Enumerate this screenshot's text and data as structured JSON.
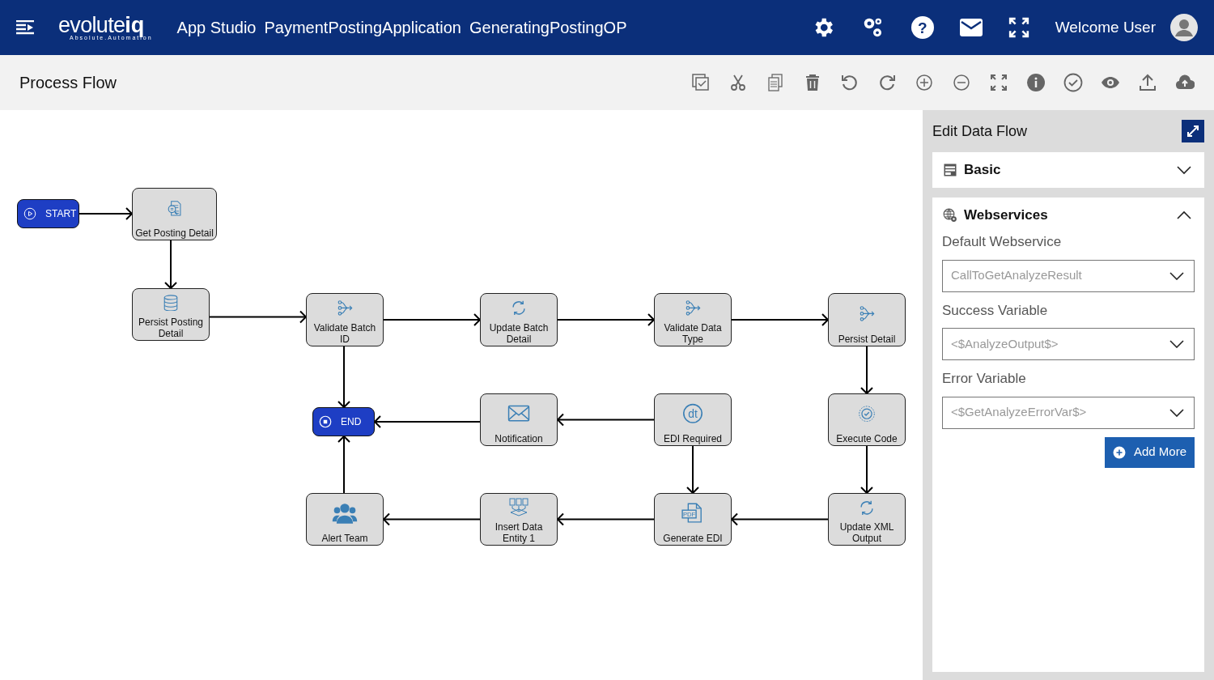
{
  "header": {
    "logo": {
      "text": "evolute",
      "accent": "iq",
      "tagline": "Absolute.Automation"
    },
    "breadcrumbs": [
      "App Studio",
      "PaymentPostingApplication",
      "GeneratingPostingOP"
    ],
    "help_icon": "?",
    "welcome": "Welcome User"
  },
  "toolbar": {
    "title": "Process Flow"
  },
  "flow": {
    "nodes": [
      {
        "label": "START",
        "kind": "terminal"
      },
      {
        "label": "Get Posting Detail",
        "kind": "task"
      },
      {
        "label": "Persist Posting Detail",
        "kind": "task"
      },
      {
        "label": "Validate Batch ID",
        "kind": "task"
      },
      {
        "label": "Update Batch Detail",
        "kind": "task"
      },
      {
        "label": "Validate Data Type",
        "kind": "task"
      },
      {
        "label": "Persist Detail",
        "kind": "task"
      },
      {
        "label": "END",
        "kind": "terminal"
      },
      {
        "label": "Notification",
        "kind": "task"
      },
      {
        "label": "EDI Required",
        "kind": "task",
        "icon_text": "dt"
      },
      {
        "label": "Execute Code",
        "kind": "task"
      },
      {
        "label": "Alert Team",
        "kind": "task"
      },
      {
        "label": "Insert Data Entity 1",
        "kind": "task"
      },
      {
        "label": "Generate EDI",
        "kind": "task",
        "icon_text": "PDF"
      },
      {
        "label": "Update XML Output",
        "kind": "task"
      }
    ]
  },
  "panel": {
    "title": "Edit Data Flow",
    "sections": [
      {
        "title": "Basic",
        "expanded": false
      },
      {
        "title": "Webservices",
        "expanded": true,
        "fields": [
          {
            "label": "Default Webservice",
            "value": "CallToGetAnalyzeResult"
          },
          {
            "label": "Success Variable",
            "value": "<$AnalyzeOutput$>"
          },
          {
            "label": "Error Variable",
            "value": "<$GetAnalyzeErrorVar$>"
          }
        ],
        "button": "Add More"
      }
    ]
  }
}
